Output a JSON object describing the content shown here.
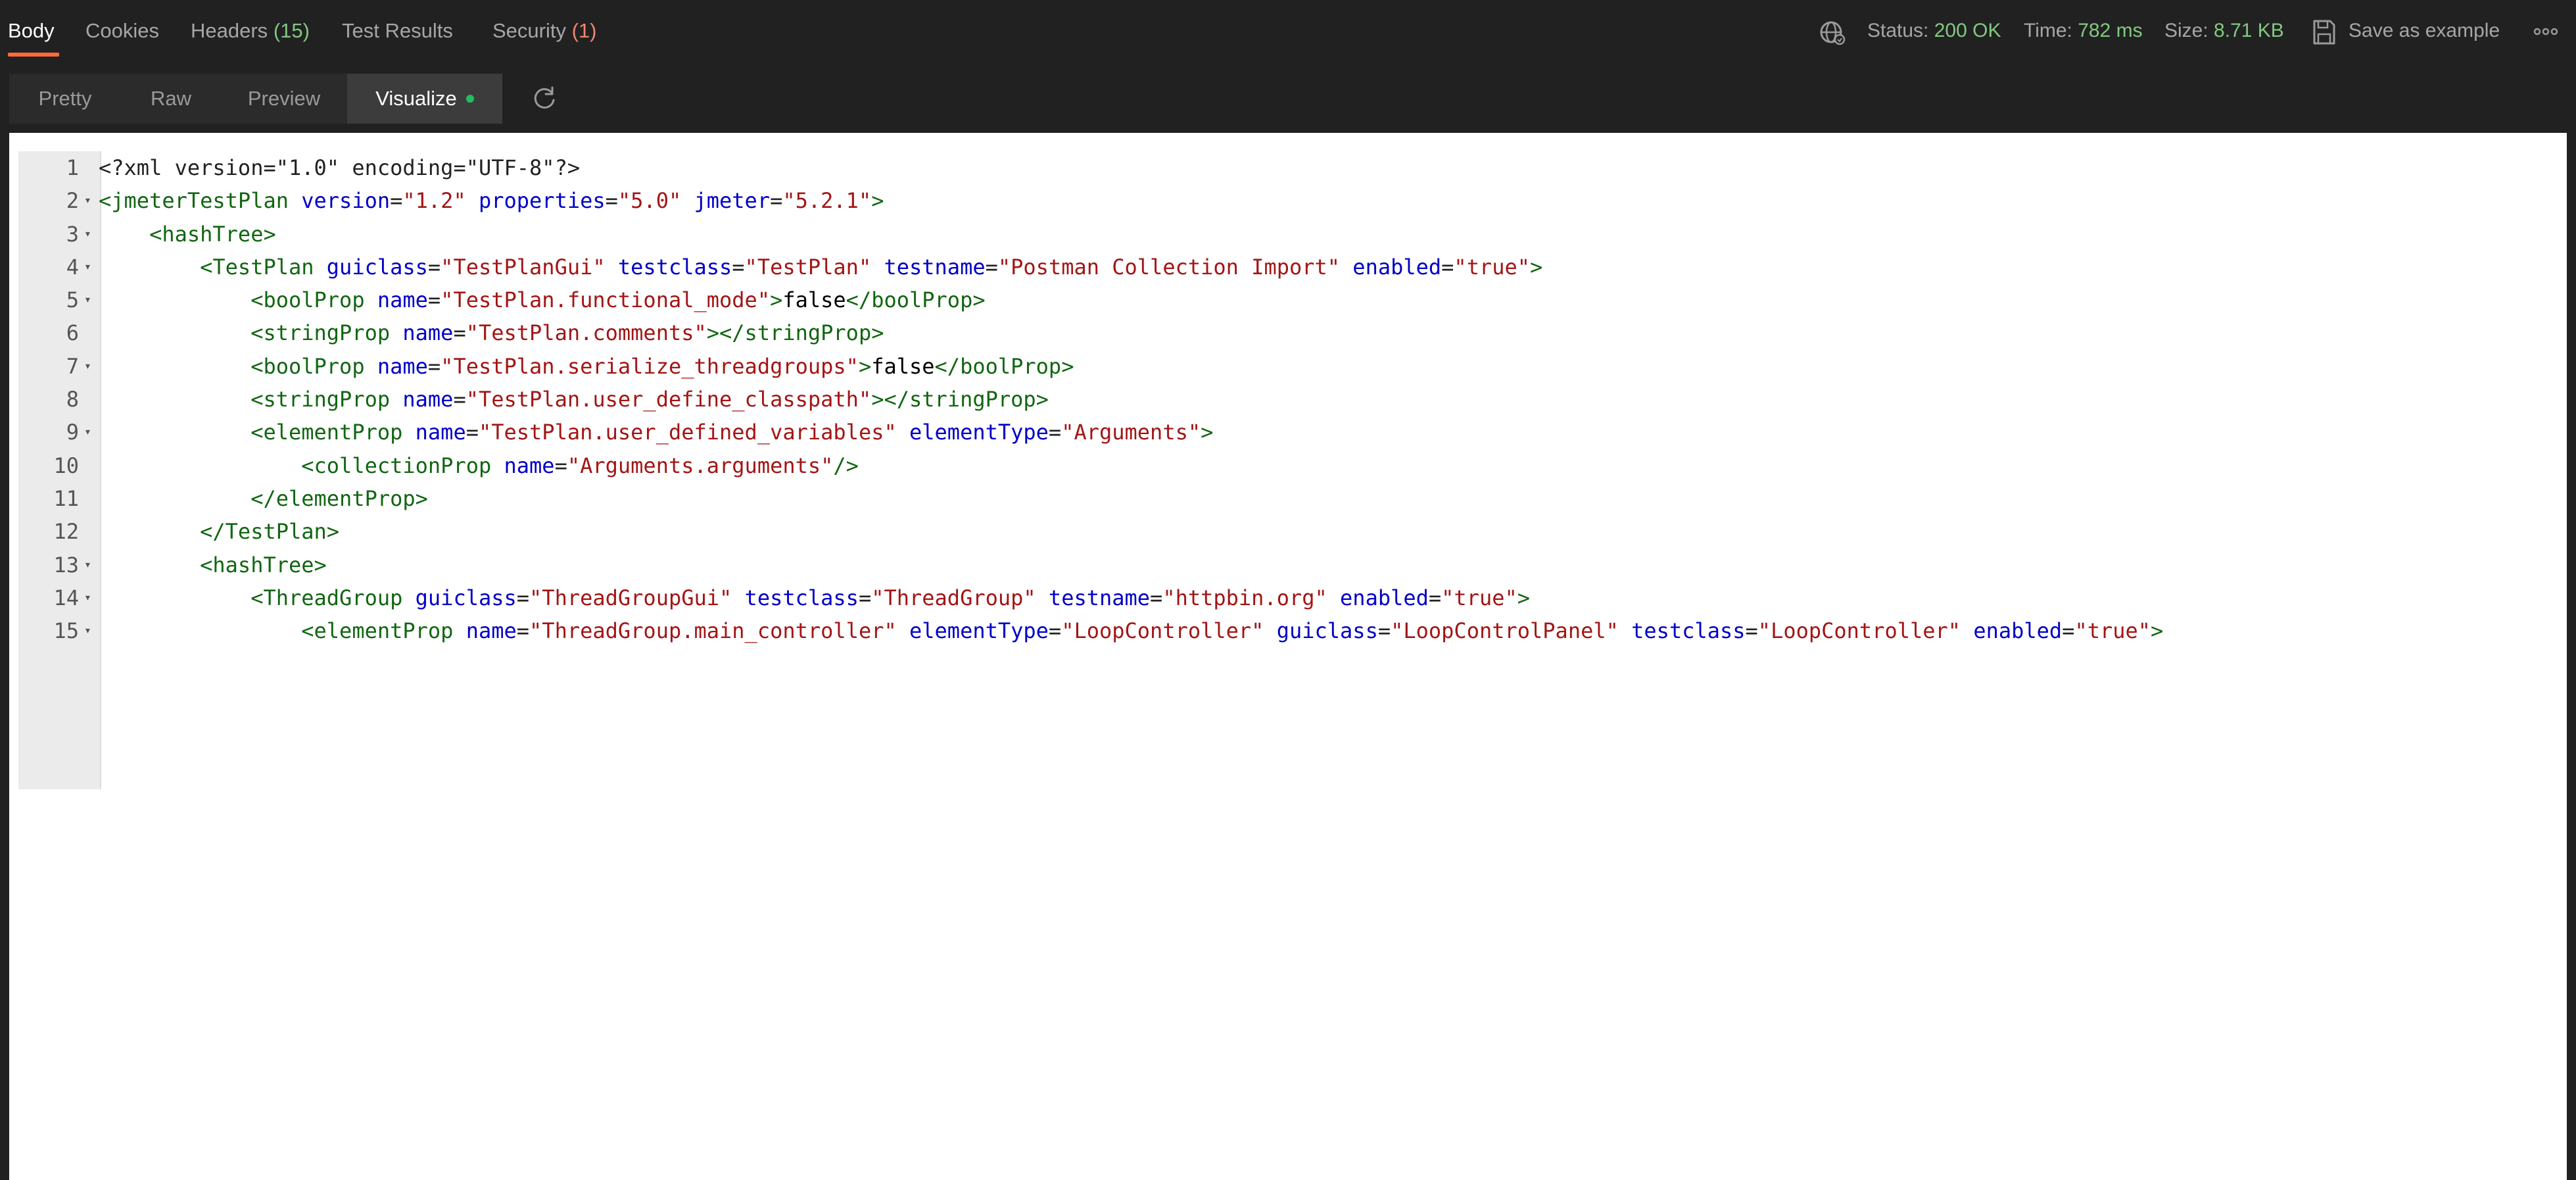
{
  "tabs": {
    "body": "Body",
    "cookies": "Cookies",
    "headers": "Headers",
    "headers_count": "(15)",
    "test_results": "Test Results",
    "security": "Security",
    "security_count": "(1)"
  },
  "status": {
    "status_label": "Status:",
    "status_value": "200 OK",
    "time_label": "Time:",
    "time_value": "782 ms",
    "size_label": "Size:",
    "size_value": "8.71 KB",
    "save_label": "Save as example"
  },
  "modes": {
    "pretty": "Pretty",
    "raw": "Raw",
    "preview": "Preview",
    "visualize": "Visualize"
  },
  "code": {
    "lines": [
      {
        "n": "1",
        "fold": "",
        "indent": "",
        "tokens": [
          [
            "plain",
            "<?xml version=\"1.0\" encoding=\"UTF-8\"?>"
          ]
        ]
      },
      {
        "n": "2",
        "fold": "▾",
        "indent": "",
        "tokens": [
          [
            "tag",
            "<jmeterTestPlan "
          ],
          [
            "attr",
            "version"
          ],
          [
            "plain",
            "="
          ],
          [
            "str",
            "\"1.2\""
          ],
          [
            "plain",
            " "
          ],
          [
            "attr",
            "properties"
          ],
          [
            "plain",
            "="
          ],
          [
            "str",
            "\"5.0\""
          ],
          [
            "plain",
            " "
          ],
          [
            "attr",
            "jmeter"
          ],
          [
            "plain",
            "="
          ],
          [
            "str",
            "\"5.2.1\""
          ],
          [
            "tag",
            ">"
          ]
        ]
      },
      {
        "n": "3",
        "fold": "▾",
        "indent": "    ",
        "tokens": [
          [
            "tag",
            "<hashTree>"
          ]
        ]
      },
      {
        "n": "4",
        "fold": "▾",
        "indent": "        ",
        "tokens": [
          [
            "tag",
            "<TestPlan "
          ],
          [
            "attr",
            "guiclass"
          ],
          [
            "plain",
            "="
          ],
          [
            "str",
            "\"TestPlanGui\""
          ],
          [
            "plain",
            " "
          ],
          [
            "attr",
            "testclass"
          ],
          [
            "plain",
            "="
          ],
          [
            "str",
            "\"TestPlan\""
          ],
          [
            "plain",
            " "
          ],
          [
            "attr",
            "testname"
          ],
          [
            "plain",
            "="
          ],
          [
            "str",
            "\"Postman Collection Import\""
          ],
          [
            "plain",
            " "
          ],
          [
            "attr",
            "enabled"
          ],
          [
            "plain",
            "="
          ],
          [
            "str",
            "\"true\""
          ],
          [
            "tag",
            ">"
          ]
        ]
      },
      {
        "n": "5",
        "fold": "▾",
        "indent": "            ",
        "tokens": [
          [
            "tag",
            "<boolProp "
          ],
          [
            "attr",
            "name"
          ],
          [
            "plain",
            "="
          ],
          [
            "str",
            "\"TestPlan.functional_mode\""
          ],
          [
            "tag",
            ">"
          ],
          [
            "txt",
            "false"
          ],
          [
            "tag",
            "</boolProp>"
          ]
        ]
      },
      {
        "n": "6",
        "fold": "",
        "indent": "            ",
        "tokens": [
          [
            "tag",
            "<stringProp "
          ],
          [
            "attr",
            "name"
          ],
          [
            "plain",
            "="
          ],
          [
            "str",
            "\"TestPlan.comments\""
          ],
          [
            "tag",
            "></stringProp>"
          ]
        ]
      },
      {
        "n": "7",
        "fold": "▾",
        "indent": "            ",
        "tokens": [
          [
            "tag",
            "<boolProp "
          ],
          [
            "attr",
            "name"
          ],
          [
            "plain",
            "="
          ],
          [
            "str",
            "\"TestPlan.serialize_threadgroups\""
          ],
          [
            "tag",
            ">"
          ],
          [
            "txt",
            "false"
          ],
          [
            "tag",
            "</boolProp>"
          ]
        ]
      },
      {
        "n": "8",
        "fold": "",
        "indent": "            ",
        "tokens": [
          [
            "tag",
            "<stringProp "
          ],
          [
            "attr",
            "name"
          ],
          [
            "plain",
            "="
          ],
          [
            "str",
            "\"TestPlan.user_define_classpath\""
          ],
          [
            "tag",
            "></stringProp>"
          ]
        ]
      },
      {
        "n": "9",
        "fold": "▾",
        "indent": "            ",
        "tokens": [
          [
            "tag",
            "<elementProp "
          ],
          [
            "attr",
            "name"
          ],
          [
            "plain",
            "="
          ],
          [
            "str",
            "\"TestPlan.user_defined_variables\""
          ],
          [
            "plain",
            " "
          ],
          [
            "attr",
            "elementType"
          ],
          [
            "plain",
            "="
          ],
          [
            "str",
            "\"Arguments\""
          ],
          [
            "tag",
            ">"
          ]
        ]
      },
      {
        "n": "10",
        "fold": "",
        "indent": "                ",
        "tokens": [
          [
            "tag",
            "<collectionProp "
          ],
          [
            "attr",
            "name"
          ],
          [
            "plain",
            "="
          ],
          [
            "str",
            "\"Arguments.arguments\""
          ],
          [
            "tag",
            "/>"
          ]
        ]
      },
      {
        "n": "11",
        "fold": "",
        "indent": "            ",
        "tokens": [
          [
            "tag",
            "</elementProp>"
          ]
        ]
      },
      {
        "n": "12",
        "fold": "",
        "indent": "        ",
        "tokens": [
          [
            "tag",
            "</TestPlan>"
          ]
        ]
      },
      {
        "n": "13",
        "fold": "▾",
        "indent": "        ",
        "tokens": [
          [
            "tag",
            "<hashTree>"
          ]
        ]
      },
      {
        "n": "14",
        "fold": "▾",
        "indent": "            ",
        "tokens": [
          [
            "tag",
            "<ThreadGroup "
          ],
          [
            "attr",
            "guiclass"
          ],
          [
            "plain",
            "="
          ],
          [
            "str",
            "\"ThreadGroupGui\""
          ],
          [
            "plain",
            " "
          ],
          [
            "attr",
            "testclass"
          ],
          [
            "plain",
            "="
          ],
          [
            "str",
            "\"ThreadGroup\""
          ],
          [
            "plain",
            " "
          ],
          [
            "attr",
            "testname"
          ],
          [
            "plain",
            "="
          ],
          [
            "str",
            "\"httpbin.org\""
          ],
          [
            "plain",
            " "
          ],
          [
            "attr",
            "enabled"
          ],
          [
            "plain",
            "="
          ],
          [
            "str",
            "\"true\""
          ],
          [
            "tag",
            ">"
          ]
        ]
      },
      {
        "n": "15",
        "fold": "▾",
        "indent": "                ",
        "tokens": [
          [
            "tag",
            "<elementProp "
          ],
          [
            "attr",
            "name"
          ],
          [
            "plain",
            "="
          ],
          [
            "str",
            "\"ThreadGroup.main_controller\""
          ],
          [
            "plain",
            " "
          ],
          [
            "attr",
            "elementType"
          ],
          [
            "plain",
            "="
          ],
          [
            "str",
            "\"LoopController\""
          ],
          [
            "plain",
            " "
          ],
          [
            "attr",
            "guiclass"
          ],
          [
            "plain",
            "="
          ],
          [
            "str",
            "\"LoopControlPanel\""
          ],
          [
            "plain",
            " "
          ],
          [
            "attr",
            "testclass"
          ],
          [
            "plain",
            "="
          ],
          [
            "str",
            "\"LoopController\""
          ],
          [
            "plain",
            " "
          ],
          [
            "attr",
            "enabled"
          ],
          [
            "plain",
            "="
          ],
          [
            "str",
            "\"true\""
          ],
          [
            "tag",
            ">"
          ]
        ]
      }
    ]
  },
  "colors": {
    "accent": "#ff6c37",
    "status_green": "#82c882",
    "warning": "#f0876e",
    "visualize_dot": "#1fbf5f"
  },
  "icons": {
    "network": "globe-icon",
    "save": "save-icon",
    "more": "more-icon",
    "refresh": "refresh-icon"
  }
}
